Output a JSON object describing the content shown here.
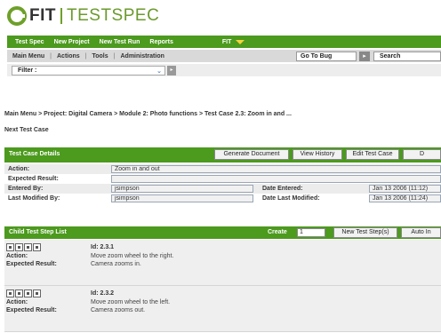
{
  "app": {
    "logo_text": "FIT",
    "logo_product": "TESTSPEC"
  },
  "topnav": {
    "items": [
      "Test Spec",
      "New Project",
      "New Test Run",
      "Reports"
    ],
    "user": "FIT"
  },
  "actionbar": {
    "items": [
      "Main Menu",
      "Actions",
      "Tools",
      "Administration"
    ],
    "separator": "|",
    "goto_label": "Go To Bug",
    "search_label": "Search"
  },
  "filter": {
    "label": "Filter :"
  },
  "breadcrumb": "Main Menu > Project: Digital Camera > Module 2: Photo functions > Test Case 2.3: Zoom in and ...",
  "subtitle": "Next Test Case",
  "details": {
    "title": "Test Case Details",
    "buttons": [
      "Generate Document",
      "View History",
      "Edit Test Case",
      "D"
    ],
    "action_label": "Action:",
    "action_value": "Zoom in and out",
    "expected_label": "Expected Result:",
    "expected_value": "",
    "entered_by_label": "Entered By:",
    "entered_by_value": "jsimpson",
    "date_entered_label": "Date Entered:",
    "date_entered_value": "Jan 13 2006 (11:12)",
    "modified_by_label": "Last Modified By:",
    "modified_by_value": "jsimpson",
    "date_modified_label": "Date Last Modified:",
    "date_modified_value": "Jan 13 2006 (11:24)"
  },
  "steps": {
    "title": "Child Test Step List",
    "create_label": "Create",
    "create_value": "1",
    "buttons": [
      "New Test Step(s)",
      "Auto In"
    ],
    "action_label": "Action:",
    "expected_label": "Expected Result:",
    "items": [
      {
        "id": "Id: 2.3.1",
        "action": "Move zoom wheel to the right.",
        "expected": "Camera zooms in."
      },
      {
        "id": "Id: 2.3.2",
        "action": "Move zoom wheel to the left.",
        "expected": "Camera zooms out."
      }
    ]
  },
  "colors": {
    "nav_green": "#4c9a1e",
    "logo_green": "#6b9a2c",
    "user_caret": "#f6d23a"
  }
}
